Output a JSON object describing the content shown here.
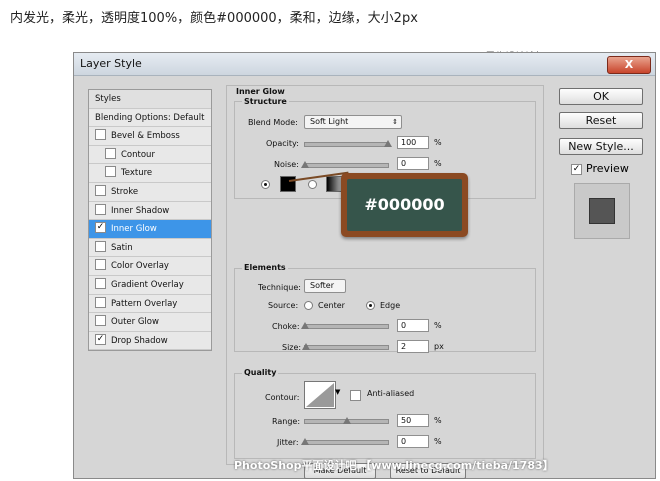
{
  "caption": "内发光，柔光，透明度100%，颜色#000000，柔和，边缘，大小2px",
  "watermark_top": "思缘设计论坛 www.MISSYUAN.COM",
  "watermark_bottom": "PhotoShop平面设计吧 【www.linecg.com/tieba/1783】",
  "window": {
    "title": "Layer Style",
    "close": "X"
  },
  "styles_panel": {
    "items": [
      {
        "label": "Styles",
        "checkbox": false,
        "checked": false
      },
      {
        "label": "Blending Options: Default",
        "checkbox": false,
        "checked": false
      },
      {
        "label": "Bevel & Emboss",
        "checkbox": true,
        "checked": false
      },
      {
        "label": "Contour",
        "checkbox": true,
        "checked": false
      },
      {
        "label": "Texture",
        "checkbox": true,
        "checked": false
      },
      {
        "label": "Stroke",
        "checkbox": true,
        "checked": false
      },
      {
        "label": "Inner Shadow",
        "checkbox": true,
        "checked": false
      },
      {
        "label": "Inner Glow",
        "checkbox": true,
        "checked": true
      },
      {
        "label": "Satin",
        "checkbox": true,
        "checked": false
      },
      {
        "label": "Color Overlay",
        "checkbox": true,
        "checked": false
      },
      {
        "label": "Gradient Overlay",
        "checkbox": true,
        "checked": false
      },
      {
        "label": "Pattern Overlay",
        "checkbox": true,
        "checked": false
      },
      {
        "label": "Outer Glow",
        "checkbox": true,
        "checked": false
      },
      {
        "label": "Drop Shadow",
        "checkbox": true,
        "checked": true
      }
    ]
  },
  "inner_glow": {
    "title": "Inner Glow",
    "structure": {
      "title": "Structure",
      "blend_mode_label": "Blend Mode:",
      "blend_mode_value": "Soft Light",
      "opacity_label": "Opacity:",
      "opacity_value": "100",
      "opacity_unit": "%",
      "opacity_level": 1.0,
      "noise_label": "Noise:",
      "noise_value": "0",
      "noise_unit": "%",
      "noise_level": 0.0,
      "color": "#000000"
    },
    "elements": {
      "title": "Elements",
      "technique_label": "Technique:",
      "technique_value": "Softer",
      "source_label": "Source:",
      "source_center": "Center",
      "source_edge": "Edge",
      "choke_label": "Choke:",
      "choke_value": "0",
      "choke_unit": "%",
      "choke_level": 0.0,
      "size_label": "Size:",
      "size_value": "2",
      "size_unit": "px",
      "size_level": 0.01
    },
    "quality": {
      "title": "Quality",
      "contour_label": "Contour:",
      "anti_aliased_label": "Anti-aliased",
      "range_label": "Range:",
      "range_value": "50",
      "range_unit": "%",
      "range_level": 0.5,
      "jitter_label": "Jitter:",
      "jitter_value": "0",
      "jitter_unit": "%",
      "jitter_level": 0.0
    },
    "make_default": "Make Default",
    "reset_default": "Reset to Default"
  },
  "buttons": {
    "ok": "OK",
    "reset": "Reset",
    "new_style": "New Style...",
    "preview": "Preview"
  },
  "callout": "#000000",
  "colors": {
    "selected_row": "#3d95e8",
    "chalkboard": "#36554b",
    "frame": "#8b4a22"
  }
}
